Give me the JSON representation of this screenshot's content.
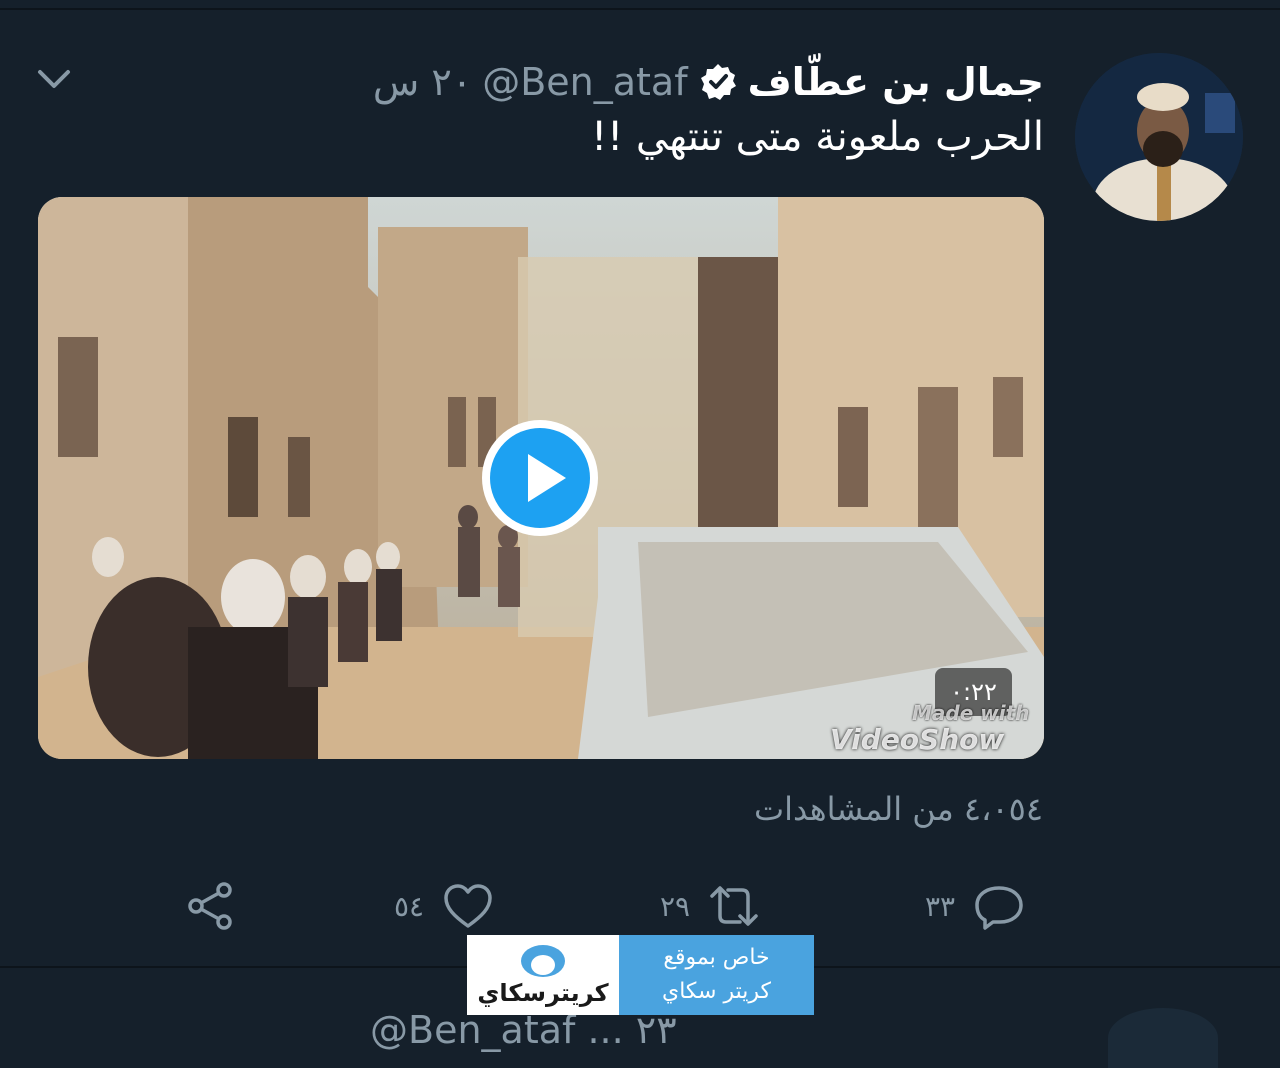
{
  "tweet": {
    "display_name": "جمال بن عطّاف",
    "handle": "@Ben_ataf",
    "time": "٢٠ س",
    "text": "الحرب ملعونة متى تنتهي !!",
    "video": {
      "duration": "٠:٢٢",
      "watermark_line1": "Made with",
      "watermark_line2": "VideoShow"
    },
    "views": "٤،٠٥٤ من المشاهدات",
    "actions": {
      "reply_count": "٣٣",
      "retweet_count": "٢٩",
      "like_count": "٥٤"
    }
  },
  "banner": {
    "logo_text": "كريترسكاي",
    "line1": "خاص بموقع",
    "line2": "كريتر سكاي"
  },
  "next_tweet_partial": "@Ben_ataf ... ٢٣",
  "colors": {
    "background": "#15202b",
    "text_primary": "#ffffff",
    "text_secondary": "#8899a6",
    "accent": "#1da1f2"
  },
  "icons": [
    "chevron-down-icon",
    "verified-badge-icon",
    "play-icon",
    "reply-icon",
    "retweet-icon",
    "like-icon",
    "share-icon"
  ]
}
